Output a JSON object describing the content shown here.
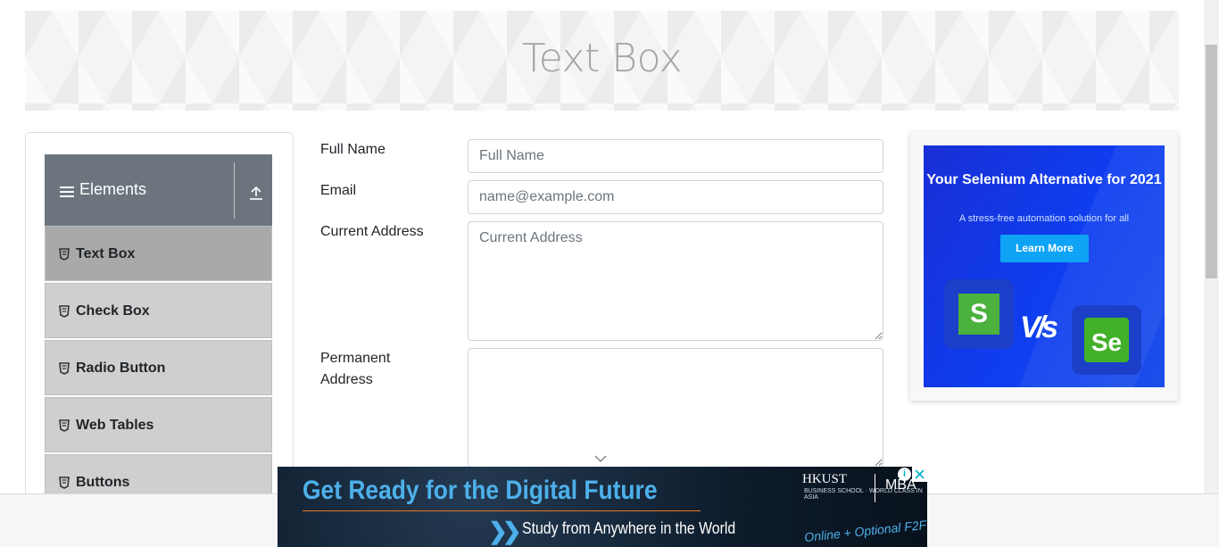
{
  "page": {
    "title": "Text Box"
  },
  "sidebar": {
    "group_title": "Elements",
    "items": [
      {
        "label": "Text Box",
        "active": true
      },
      {
        "label": "Check Box",
        "active": false
      },
      {
        "label": "Radio Button",
        "active": false
      },
      {
        "label": "Web Tables",
        "active": false
      },
      {
        "label": "Buttons",
        "active": false
      }
    ]
  },
  "form": {
    "full_name": {
      "label": "Full Name",
      "value": "",
      "placeholder": "Full Name"
    },
    "email": {
      "label": "Email",
      "value": "",
      "placeholder": "name@example.com"
    },
    "current_address": {
      "label": "Current Address",
      "value": "",
      "placeholder": "Current Address"
    },
    "permanent_address": {
      "label": "Permanent Address",
      "value": "",
      "placeholder": ""
    }
  },
  "ad_right": {
    "title": "Your Selenium Alternative for 2021",
    "subtitle": "A stress-free automation solution for all",
    "button": "Learn More",
    "left_logo": "S",
    "versus": "V/s",
    "right_logo": "Se"
  },
  "ad_bottom": {
    "headline": "Get Ready for the Digital Future",
    "subline": "Study from Anywhere in the World",
    "brand": "HKUST",
    "brand_sub": "BUSINESS SCHOOL · WORLD CLASS IN ASIA",
    "program": "MBA",
    "tagline": "Online + Optional F2F"
  },
  "colors": {
    "sidebar_header": "#6c757d",
    "menu_item": "#cfcfcf",
    "menu_item_active": "#a9a9a9",
    "ad_blue": "#1a2fd6",
    "accent_cyan": "#4db0ea"
  }
}
